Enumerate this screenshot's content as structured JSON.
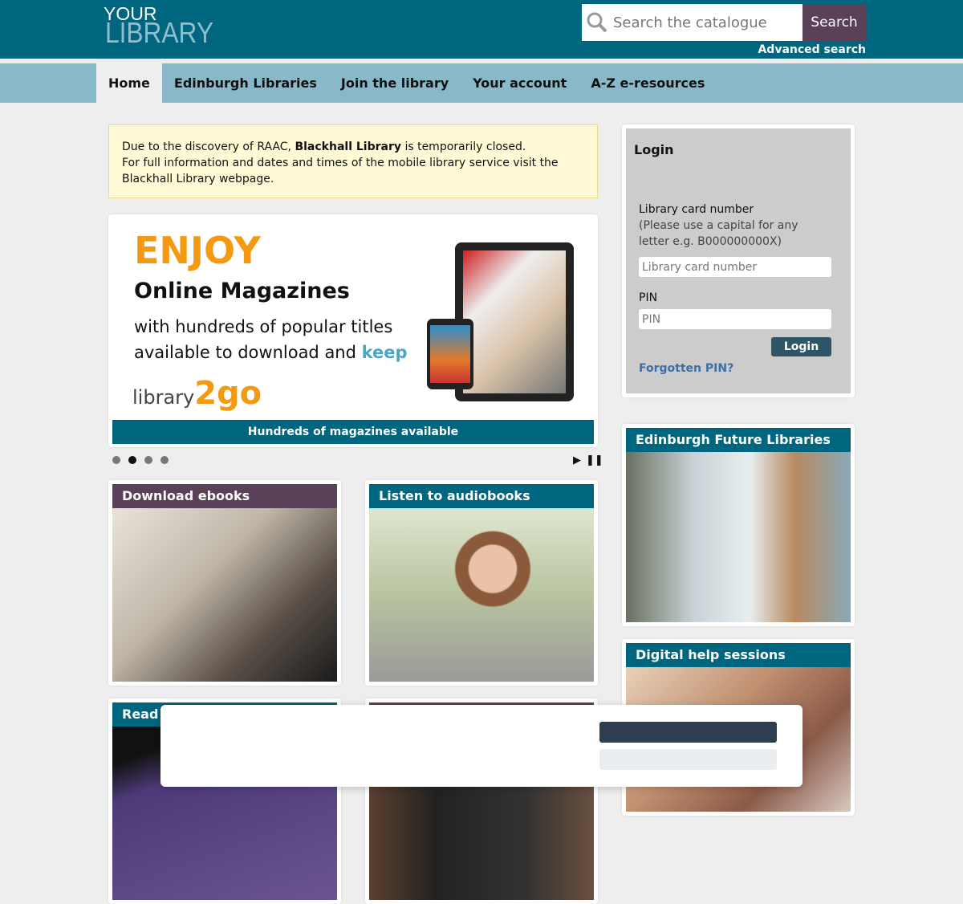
{
  "header": {
    "logo_top": "YOUR",
    "logo_bottom": "LIBRARY",
    "search_placeholder": "Search the catalogue",
    "search_button": "Search",
    "advanced_search": "Advanced search"
  },
  "nav": [
    {
      "label": "Home",
      "active": true
    },
    {
      "label": "Edinburgh Libraries"
    },
    {
      "label": "Join the library"
    },
    {
      "label": "Your account"
    },
    {
      "label": "A-Z e-resources"
    }
  ],
  "notice": {
    "pre": "Due to the discovery of RAAC, ",
    "bold": "Blackhall Library",
    "post": " is temporarily closed.",
    "line2": "For full information and dates and times of the mobile library service visit the Blackhall Library webpage."
  },
  "banner": {
    "headline": "ENJOY",
    "title": "Online Magazines",
    "line1": "with hundreds of popular titles",
    "line2": "available to download and ",
    "keep": "keep",
    "brand": "library",
    "brand2": "2go",
    "caption": "Hundreds of magazines available",
    "slides": 4,
    "active_slide": 2
  },
  "tiles": [
    {
      "title": "Download ebooks",
      "color": "#5a4158"
    },
    {
      "title": "Listen to audiobooks",
      "color": "#00667f"
    },
    {
      "title": "Read m",
      "color": "#00667f"
    },
    {
      "title": "",
      "color": "#5a4158"
    }
  ],
  "login": {
    "title": "Login",
    "card_label": "Library card number",
    "card_hint": "(Please use a capital for any letter e.g. B000000000X)",
    "card_placeholder": "Library card number",
    "pin_label": "PIN",
    "pin_placeholder": "PIN",
    "button": "Login",
    "forgot": "Forgotten PIN?"
  },
  "side_tiles": [
    {
      "title": "Edinburgh Future Libraries"
    },
    {
      "title": "Digital help sessions"
    }
  ],
  "colors": {
    "header": "#00667f",
    "nav": "#89b9c9",
    "accent_purple": "#5a4158",
    "orange": "#f39a12"
  }
}
